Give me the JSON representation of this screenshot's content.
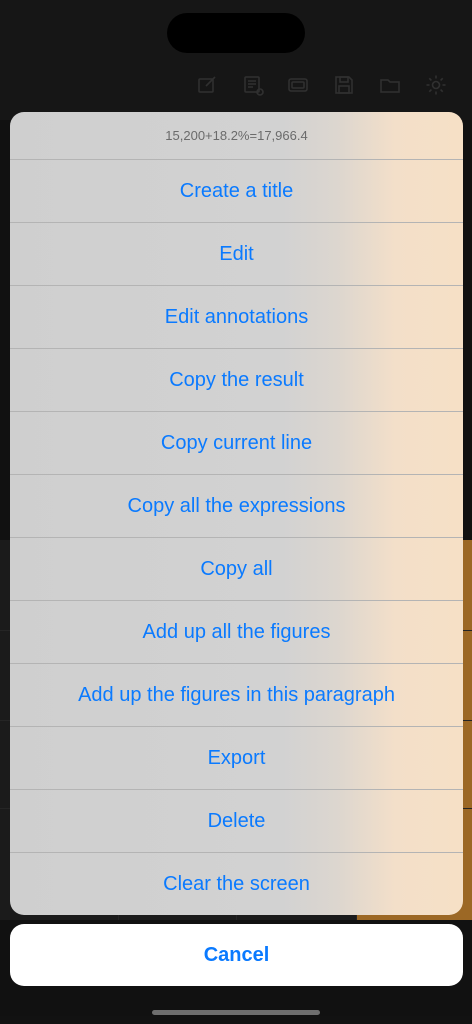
{
  "action_sheet": {
    "title": "15,200+18.2%=17,966.4",
    "items": [
      {
        "label": "Create a title"
      },
      {
        "label": "Edit"
      },
      {
        "label": "Edit annotations"
      },
      {
        "label": "Copy the result"
      },
      {
        "label": "Copy current line"
      },
      {
        "label": "Copy all the expressions"
      },
      {
        "label": "Copy all"
      },
      {
        "label": "Add up all the figures"
      },
      {
        "label": "Add up the figures in this paragraph"
      },
      {
        "label": "Export"
      },
      {
        "label": "Delete"
      },
      {
        "label": "Clear the screen"
      }
    ],
    "cancel_label": "Cancel"
  },
  "toolbar": {
    "icons": [
      "edit-icon",
      "note-icon",
      "screen-icon",
      "save-icon",
      "folder-icon",
      "gear-icon"
    ]
  },
  "colors": {
    "accent": "#0a7aff",
    "operator_key": "#f0a03a"
  }
}
